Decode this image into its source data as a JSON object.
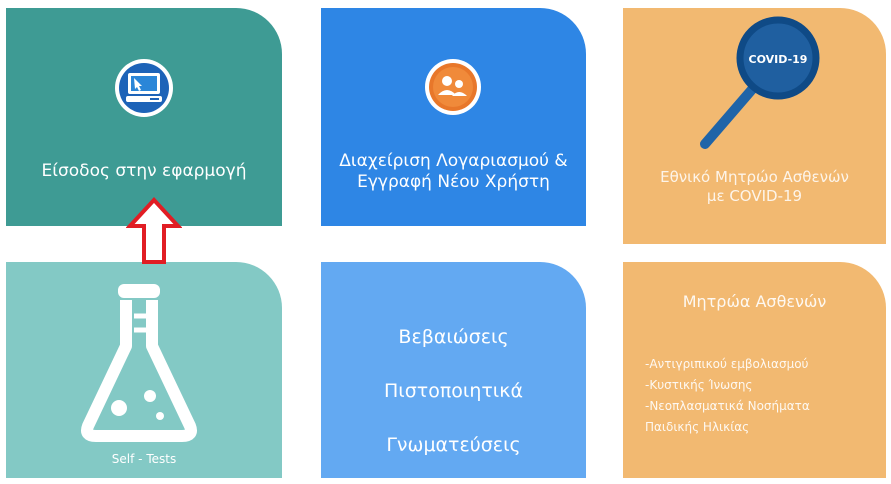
{
  "colors": {
    "tile_login": "#3e9b94",
    "tile_account": "#2e86e5",
    "tile_covid": "#f2b971",
    "tile_selftests": "#83c9c5",
    "tile_certificates": "#63a9f2",
    "tile_registries": "#f2b971",
    "arrow": "#e11d24"
  },
  "tiles": {
    "login": {
      "label": "Είσοδος στην εφαρμογή",
      "icon": "computer-icon"
    },
    "account": {
      "label_line1": "Διαχείριση Λογαριασμού &",
      "label_line2": "Εγγραφή Νέου Χρήστη",
      "icon": "users-icon"
    },
    "covid": {
      "label_line1": "Εθνικό Μητρώο Ασθενών",
      "label_line2": "με COVID-19",
      "badge": "COVID-19",
      "icon": "magnifier-icon"
    },
    "selftests": {
      "label": "Self - Tests",
      "icon": "flask-icon"
    },
    "certificates": {
      "lines": [
        "Βεβαιώσεις",
        "Πιστοποιητικά",
        "Γνωματεύσεις"
      ]
    },
    "registries": {
      "title": "Μητρώα Ασθενών",
      "items": [
        "-Αντιγριπικού εμβολιασμού",
        "-Κυστικής Ίνωσης",
        "-Νεοπλασματικά Νοσήματα",
        "Παιδικής Ηλικίας"
      ]
    }
  }
}
